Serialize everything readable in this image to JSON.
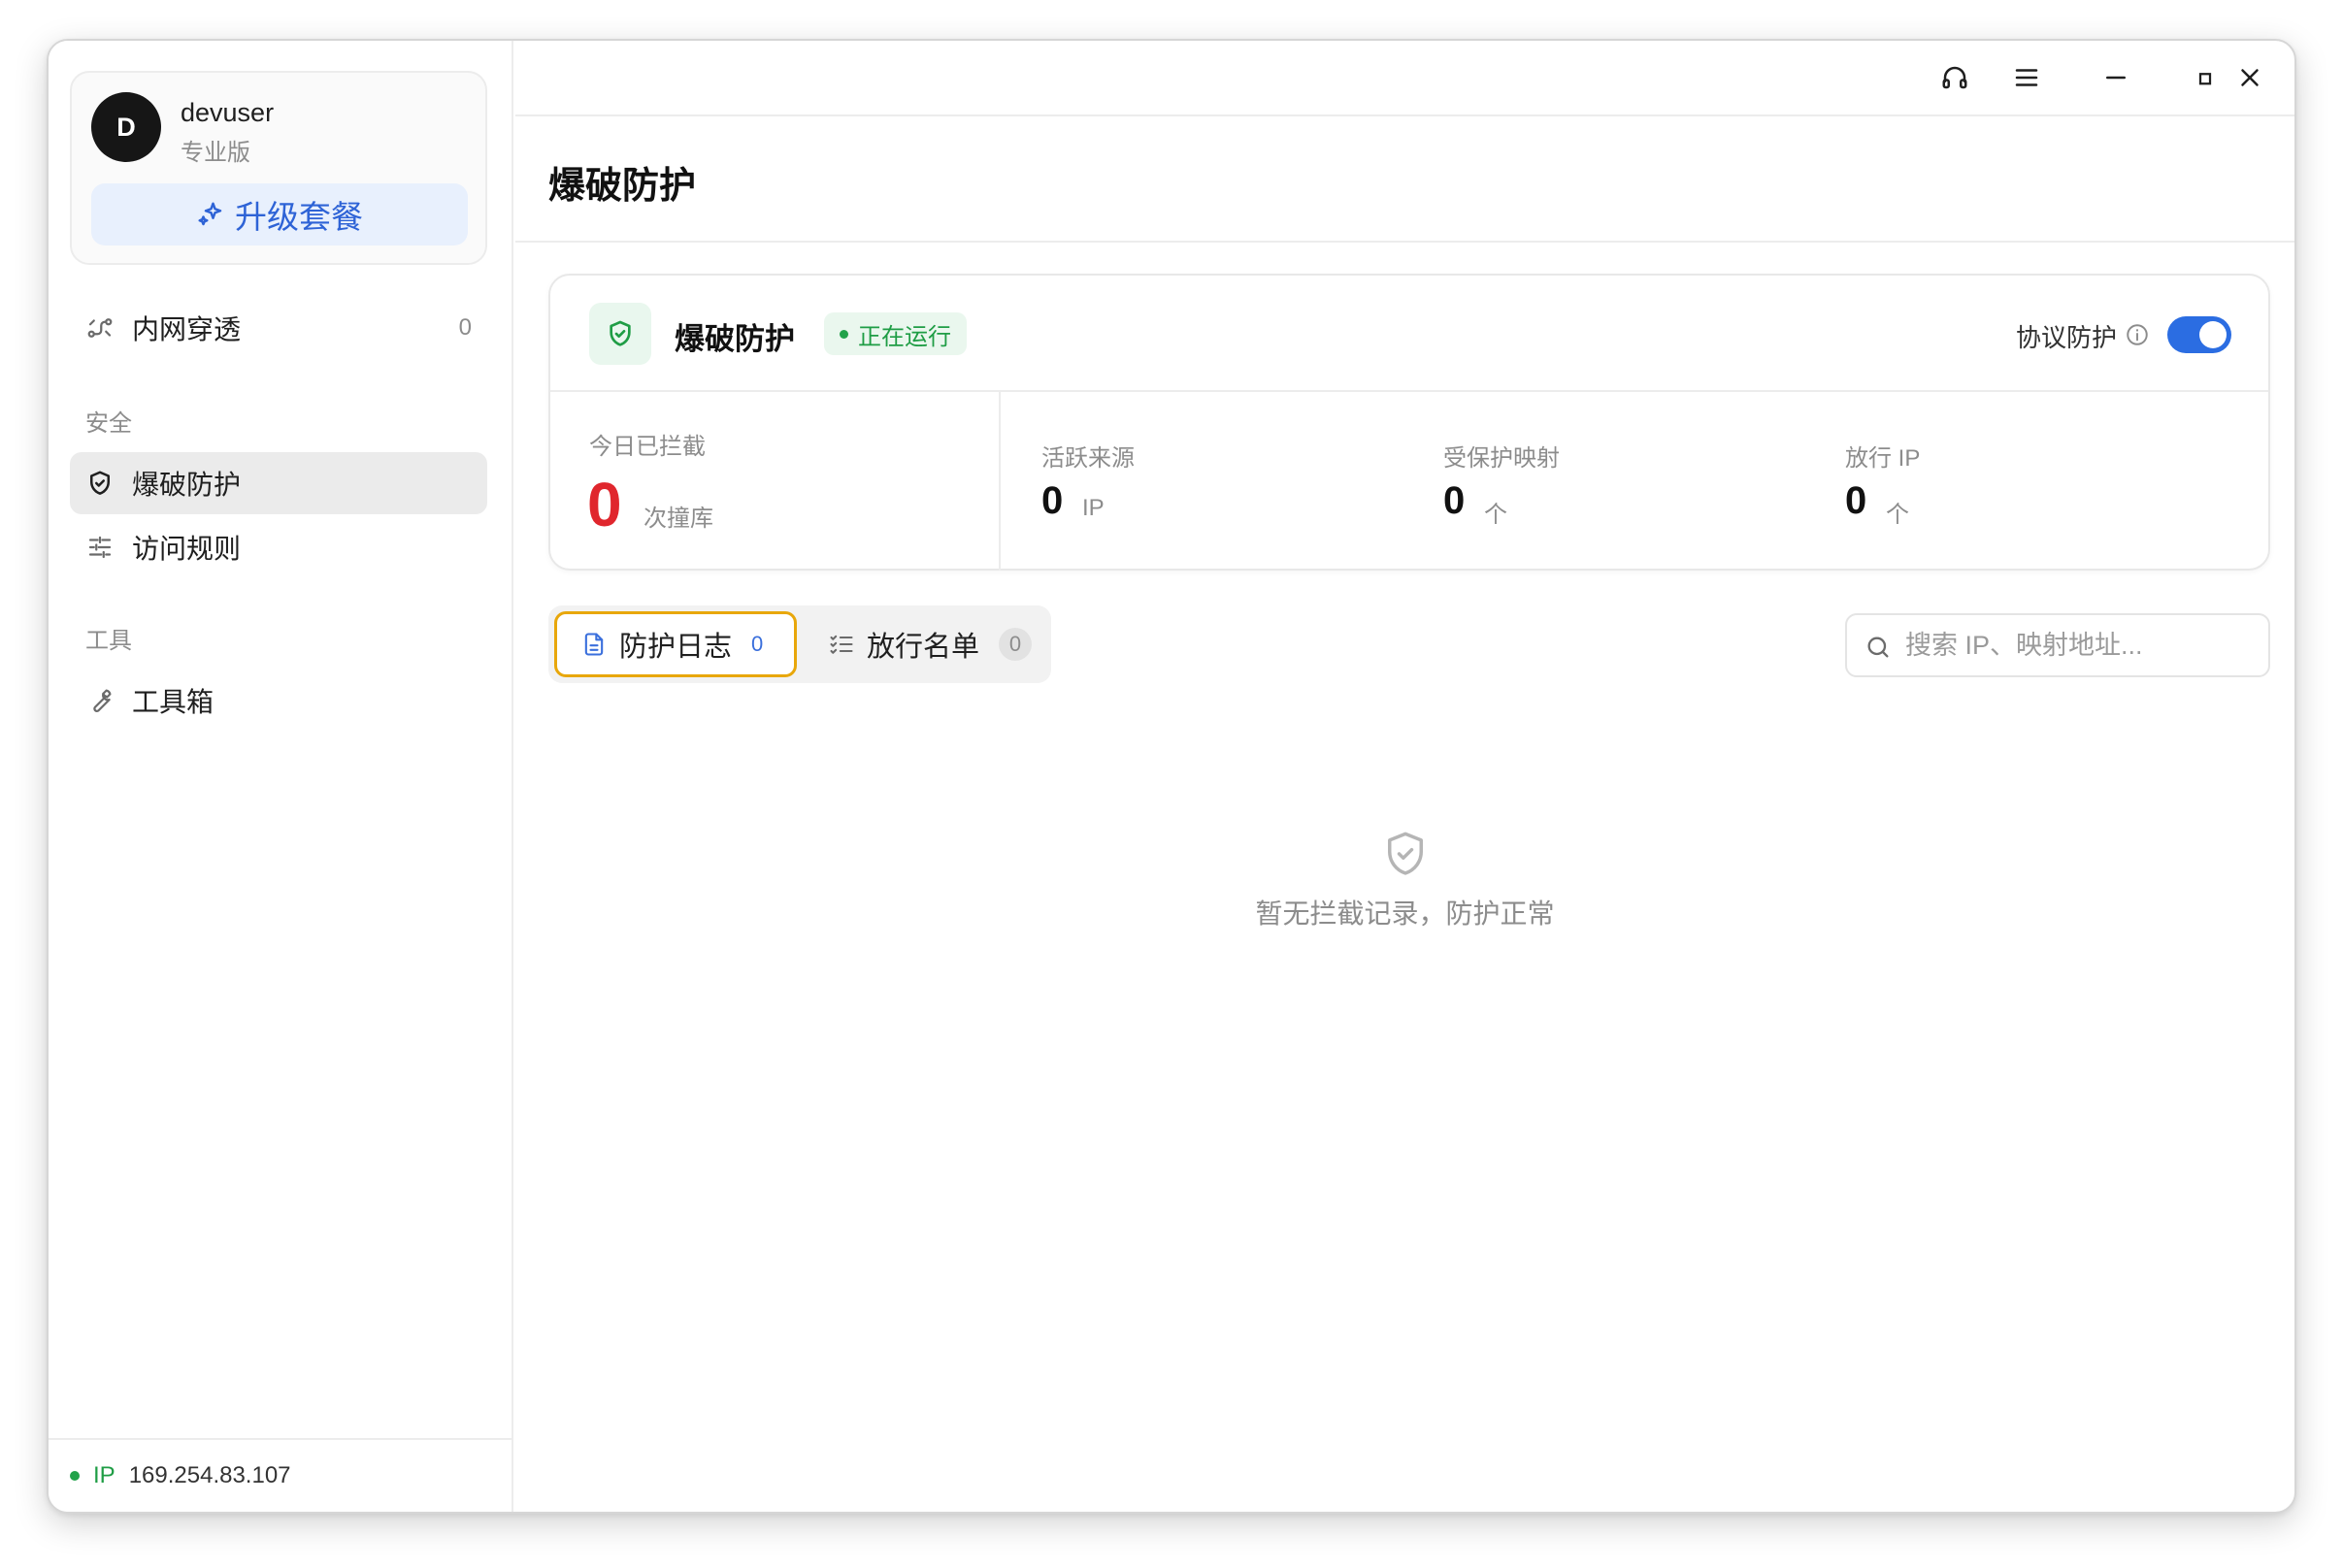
{
  "user": {
    "avatar_letter": "D",
    "name": "devuser",
    "plan": "专业版",
    "upgrade_label": "升级套餐"
  },
  "sidebar": {
    "items": [
      {
        "label": "内网穿透",
        "count": "0",
        "icon": "tunnel-icon"
      },
      {
        "label": "爆破防护",
        "icon": "shield-icon",
        "active": true
      },
      {
        "label": "访问规则",
        "icon": "sliders-icon"
      },
      {
        "label": "工具箱",
        "icon": "wrench-icon"
      }
    ],
    "sections": {
      "security": "安全",
      "tools": "工具"
    },
    "footer": {
      "ip_label": "IP",
      "ip_value": "169.254.83.107"
    }
  },
  "titlebar": {
    "icons": [
      "headset-icon",
      "menu-icon",
      "minimize-icon",
      "maximize-icon",
      "close-icon"
    ]
  },
  "page": {
    "title": "爆破防护"
  },
  "status_card": {
    "title": "爆破防护",
    "status": "正在运行",
    "protocol_label": "协议防护",
    "protocol_enabled": true,
    "blocked_today": {
      "label": "今日已拦截",
      "value": "0",
      "unit": "次撞库"
    },
    "active_sources": {
      "label": "活跃来源",
      "value": "0",
      "unit": "IP"
    },
    "protected_mappings": {
      "label": "受保护映射",
      "value": "0",
      "unit": "个"
    },
    "allowed_ips": {
      "label": "放行 IP",
      "value": "0",
      "unit": "个"
    }
  },
  "tabs": [
    {
      "label": "防护日志",
      "count": "0",
      "active": true
    },
    {
      "label": "放行名单",
      "count": "0",
      "active": false
    }
  ],
  "search": {
    "placeholder": "搜索 IP、映射地址...",
    "value": ""
  },
  "empty_state": {
    "text": "暂无拦截记录，防护正常"
  },
  "colors": {
    "accent": "#2b6de2",
    "success": "#1f9d45",
    "danger": "#e0262d",
    "tab_focus": "#e8a70b"
  }
}
